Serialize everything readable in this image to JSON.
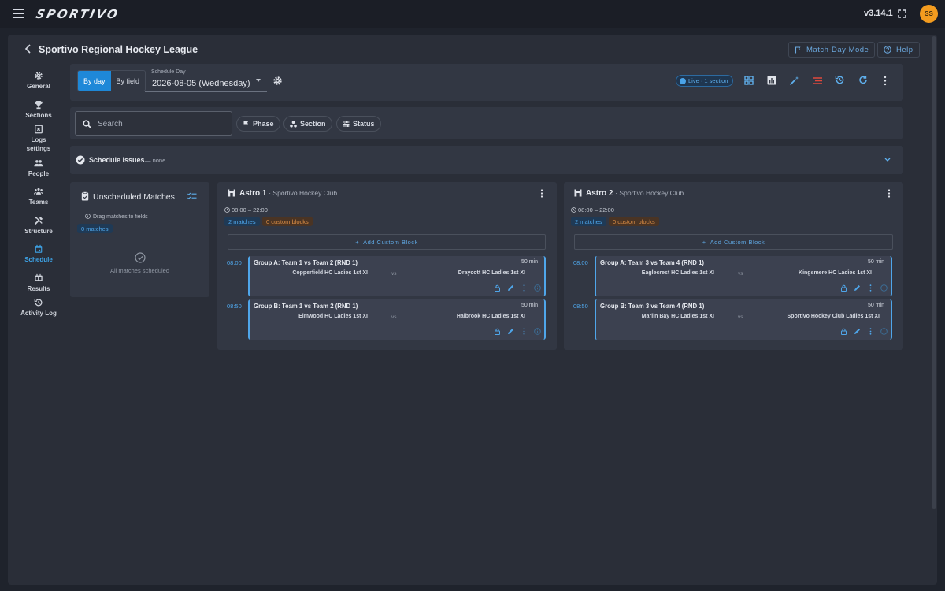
{
  "app": {
    "name": "SPORTIVO",
    "version": "v3.14.1",
    "user_initials": "SS"
  },
  "colors": {
    "accent": "#1e88d8",
    "link": "#4fa6ea",
    "avatar": "#f39c1f",
    "custom_block": "#d98c45"
  },
  "header": {
    "title": "Sportivo Regional Hockey League",
    "match_day_mode": "Match-Day Mode",
    "help": "Help"
  },
  "sidebar": {
    "items": [
      {
        "label": "General",
        "icon": "gear-icon"
      },
      {
        "label": "Sections",
        "icon": "trophy-icon"
      },
      {
        "label": "Logs settings",
        "icon": "logs-icon"
      },
      {
        "label": "People",
        "icon": "people-icon"
      },
      {
        "label": "Teams",
        "icon": "teams-icon"
      },
      {
        "label": "Structure",
        "icon": "tools-icon"
      },
      {
        "label": "Schedule",
        "icon": "calendar-icon",
        "active": true
      },
      {
        "label": "Results",
        "icon": "scoreboard-icon"
      },
      {
        "label": "Activity Log",
        "icon": "history-icon"
      }
    ]
  },
  "toolbar": {
    "view_by_day": "By day",
    "view_by_field": "By field",
    "schedule_day_label": "Schedule Day",
    "schedule_day_value": "2026-08-05 (Wednesday)",
    "live_status": "Live · 1 section",
    "icons": [
      "grid-view-icon",
      "bar-chart-icon",
      "magic-wand-icon",
      "conflicts-icon",
      "history-icon",
      "refresh-icon",
      "more-vert-icon"
    ]
  },
  "filters": {
    "search_placeholder": "Search",
    "phase": "Phase",
    "section": "Section",
    "status": "Status"
  },
  "issues": {
    "title": "Schedule issues",
    "summary": "— none"
  },
  "unscheduled": {
    "title": "Unscheduled Matches",
    "hint": "Drag matches to fields",
    "count_badge": "0 matches",
    "empty_text": "All matches scheduled"
  },
  "fields": [
    {
      "name": "Astro 1",
      "club": "· Sportivo Hockey Club",
      "hours": "08:00 – 22:00",
      "matches_badge": "2 matches",
      "custom_badge": "0 custom blocks",
      "add_block": "Add Custom Block",
      "matches": [
        {
          "time": "08:00",
          "title": "Group A: Team 1 vs Team 2 (RND 1)",
          "duration": "50 min",
          "home": "Copperfield HC Ladies 1st XI",
          "vs": "vs",
          "away": "Draycott HC Ladies 1st XI"
        },
        {
          "time": "08:50",
          "title": "Group B: Team 1 vs Team 2 (RND 1)",
          "duration": "50 min",
          "home": "Elmwood HC Ladies 1st XI",
          "vs": "vs",
          "away": "Halbrook HC Ladies 1st XI"
        }
      ]
    },
    {
      "name": "Astro 2",
      "club": "· Sportivo Hockey Club",
      "hours": "08:00 – 22:00",
      "matches_badge": "2 matches",
      "custom_badge": "0 custom blocks",
      "add_block": "Add Custom Block",
      "matches": [
        {
          "time": "08:00",
          "title": "Group A: Team 3 vs Team 4 (RND 1)",
          "duration": "50 min",
          "home": "Eaglecrest HC Ladies 1st XI",
          "vs": "vs",
          "away": "Kingsmere HC Ladies 1st XI"
        },
        {
          "time": "08:50",
          "title": "Group B: Team 3 vs Team 4 (RND 1)",
          "duration": "50 min",
          "home": "Marlin Bay HC Ladies 1st XI",
          "vs": "vs",
          "away": "Sportivo Hockey Club Ladies 1st XI"
        }
      ]
    }
  ]
}
